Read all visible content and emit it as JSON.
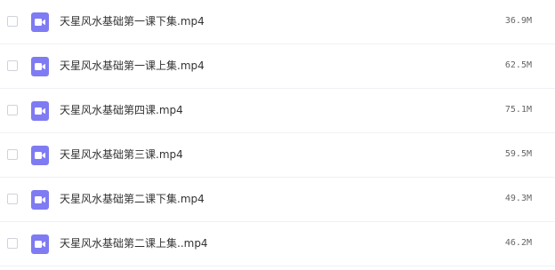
{
  "files": [
    {
      "name": "天星风水基础第一课下集.mp4",
      "size": "36.9M",
      "icon": "video-icon"
    },
    {
      "name": "天星风水基础第一课上集.mp4",
      "size": "62.5M",
      "icon": "video-icon"
    },
    {
      "name": "天星风水基础第四课.mp4",
      "size": "75.1M",
      "icon": "video-icon"
    },
    {
      "name": "天星风水基础第三课.mp4",
      "size": "59.5M",
      "icon": "video-icon"
    },
    {
      "name": "天星风水基础第二课下集.mp4",
      "size": "49.3M",
      "icon": "video-icon"
    },
    {
      "name": "天星风水基础第二课上集..mp4",
      "size": "46.2M",
      "icon": "video-icon"
    }
  ],
  "colors": {
    "icon_background": "#7f7bf2",
    "row_divider": "#f0f1f4",
    "text": "#333333",
    "size_text": "#666666"
  }
}
